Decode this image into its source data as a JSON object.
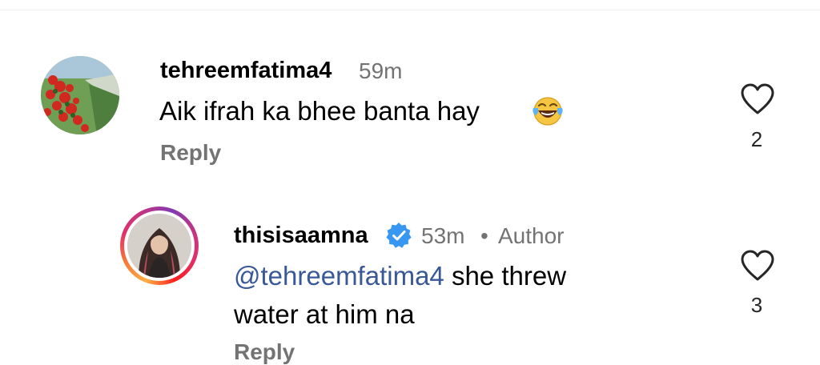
{
  "comments": [
    {
      "username": "tehreemfatima4",
      "time": "59m",
      "text": "Aik ifrah ka bhee banta hay",
      "emoji_icon": "face-with-tears-of-joy-icon",
      "reply_label": "Reply",
      "like_count": "2",
      "avatar_icon": "red-flowers-garden-avatar"
    },
    {
      "username": "thisisaamna",
      "verified": true,
      "time": "53m",
      "separator": "•",
      "author_badge": "Author",
      "mention": "@tehreemfatima4",
      "text_after_mention": " she threw",
      "text_line2": "water at him na",
      "reply_label": "Reply",
      "like_count": "3",
      "avatar_icon": "woman-portrait-avatar"
    }
  ],
  "colors": {
    "username": "#000000",
    "meta_gray": "#737373",
    "mention_blue": "#385898",
    "verified_blue": "#3897f0",
    "divider": "#efefef"
  }
}
